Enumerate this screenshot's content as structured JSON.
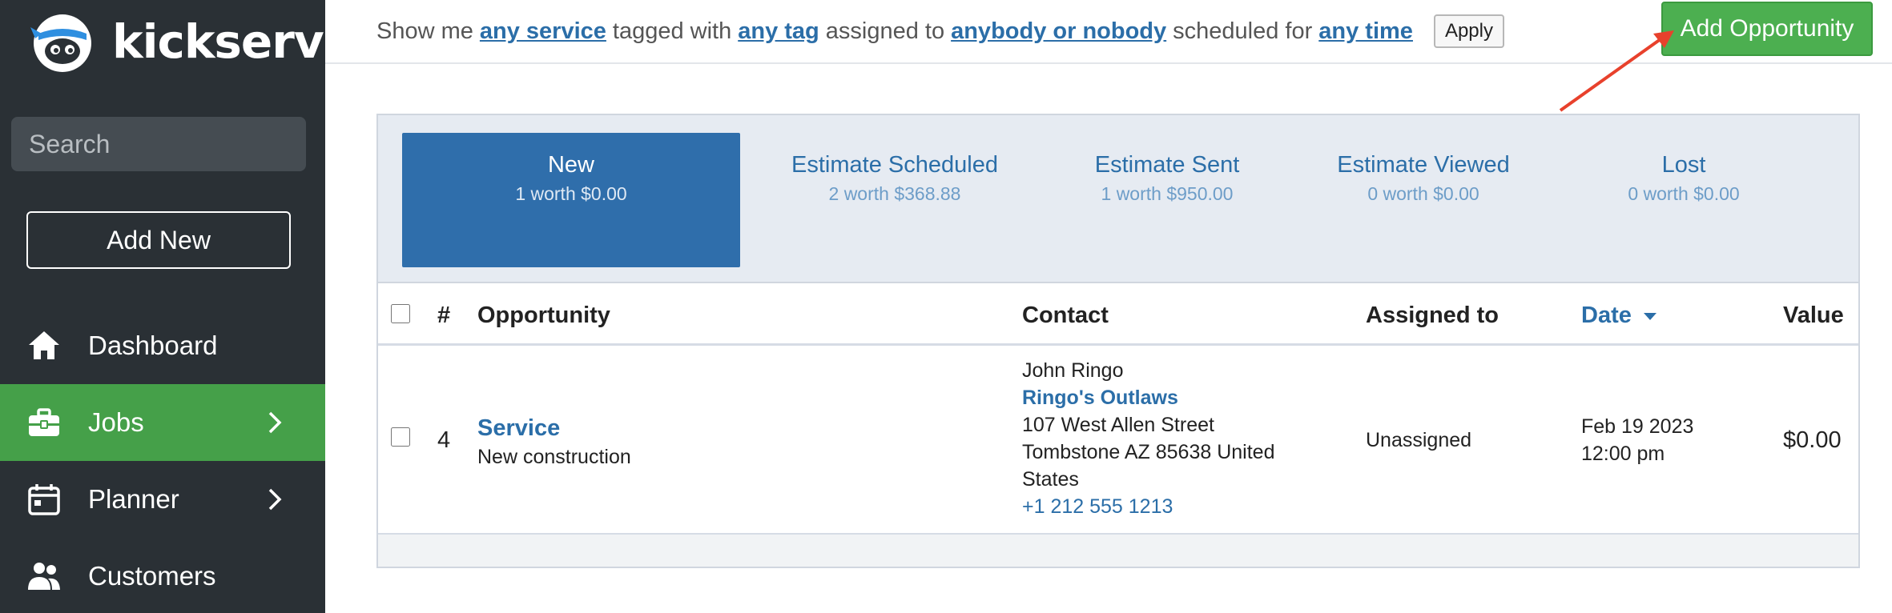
{
  "app": {
    "logo_text": "kickserv"
  },
  "sidebar": {
    "search_placeholder": "Search",
    "add_new_label": "Add New",
    "items": [
      {
        "label": "Dashboard",
        "icon": "home-icon",
        "active": false,
        "has_chevron": false
      },
      {
        "label": "Jobs",
        "icon": "briefcase-icon",
        "active": true,
        "has_chevron": true
      },
      {
        "label": "Planner",
        "icon": "calendar-icon",
        "active": false,
        "has_chevron": true
      },
      {
        "label": "Customers",
        "icon": "people-icon",
        "active": false,
        "has_chevron": false
      }
    ]
  },
  "filters": {
    "t1": "Show me",
    "service": "any service",
    "t2": "tagged with",
    "tag": "any tag",
    "t3": "assigned to",
    "assignee": "anybody or nobody",
    "t4": "scheduled for",
    "time": "any time",
    "apply_label": "Apply"
  },
  "add_opportunity_label": "Add Opportunity",
  "stages": [
    {
      "name": "New",
      "summary": "1 worth $0.00",
      "active": true
    },
    {
      "name": "Estimate Scheduled",
      "summary": "2 worth $368.88",
      "active": false
    },
    {
      "name": "Estimate Sent",
      "summary": "1 worth $950.00",
      "active": false
    },
    {
      "name": "Estimate Viewed",
      "summary": "0 worth $0.00",
      "active": false
    },
    {
      "name": "Lost",
      "summary": "0 worth $0.00",
      "active": false
    }
  ],
  "table": {
    "headers": {
      "num": "#",
      "opportunity": "Opportunity",
      "contact": "Contact",
      "assigned": "Assigned to",
      "date": "Date",
      "value": "Value"
    },
    "rows": [
      {
        "num": "4",
        "title": "Service",
        "subtitle": "New construction",
        "contact_name": "John Ringo",
        "company": "Ringo's Outlaws",
        "address1": "107 West Allen Street",
        "address2": "Tombstone AZ 85638 United",
        "address3": "States",
        "phone": "+1 212 555 1213",
        "assigned": "Unassigned",
        "date": "Feb 19 2023",
        "time": "12:00 pm",
        "value": "$0.00"
      }
    ]
  },
  "colors": {
    "sidebar_bg": "#2a3035",
    "active_green": "#45a049",
    "link_blue": "#2b6ea8",
    "stage_active": "#2f6eab",
    "arrow_red": "#e8412c"
  }
}
